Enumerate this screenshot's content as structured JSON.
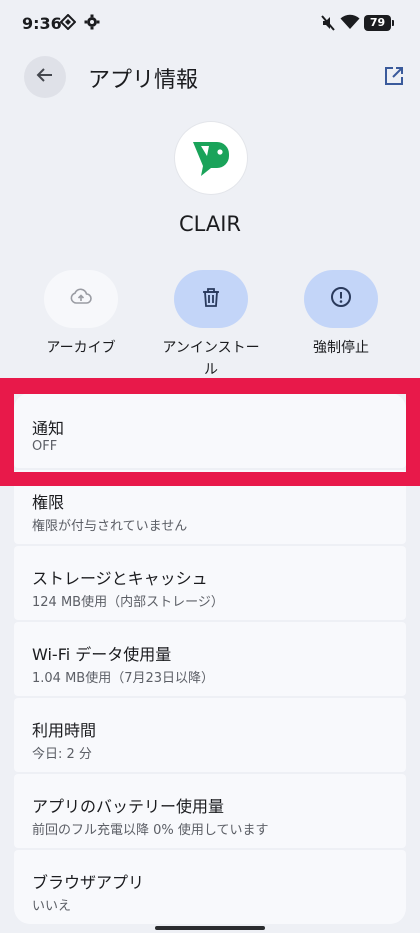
{
  "status_bar": {
    "time": "9:36",
    "battery": "79"
  },
  "header": {
    "title": "アプリ情報"
  },
  "app": {
    "name": "CLAIR",
    "icon": "clair-logo",
    "brand_color": "#1aa35a"
  },
  "actions": [
    {
      "label": "アーカイブ",
      "icon": "cloud-upload-icon"
    },
    {
      "label": "アンインストール",
      "icon": "trash-icon"
    },
    {
      "label": "強制停止",
      "icon": "alert-circle-icon"
    }
  ],
  "settings": [
    {
      "title": "通知",
      "subtitle": "OFF"
    },
    {
      "title": "権限",
      "subtitle": "権限が付与されていません"
    },
    {
      "title": "ストレージとキャッシュ",
      "subtitle": "124 MB使用（内部ストレージ）"
    },
    {
      "title": "Wi-Fi データ使用量",
      "subtitle": "1.04 MB使用（7月23日以降）"
    },
    {
      "title": "利用時間",
      "subtitle": "今日: 2 分"
    },
    {
      "title": "アプリのバッテリー使用量",
      "subtitle": "前回のフル充電以降 0% 使用しています"
    },
    {
      "title": "ブラウザアプリ",
      "subtitle": "いいえ"
    }
  ],
  "colors": {
    "background": "#eef0f5",
    "highlight": "#e8194a",
    "accent_button": "#c3d5f8"
  }
}
